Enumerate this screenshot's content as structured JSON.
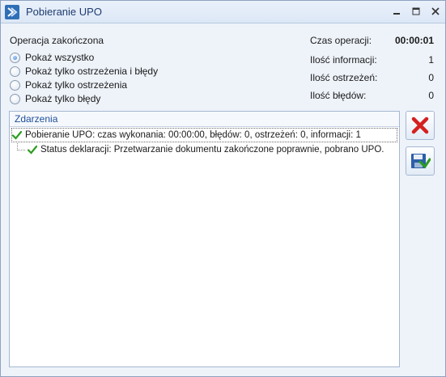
{
  "window": {
    "title": "Pobieranie UPO"
  },
  "status": {
    "title": "Operacja zakończona",
    "filters": [
      {
        "label": "Pokaż wszystko",
        "checked": true
      },
      {
        "label": "Pokaż tylko ostrzeżenia i błędy",
        "checked": false
      },
      {
        "label": "Pokaż tylko ostrzeżenia",
        "checked": false
      },
      {
        "label": "Pokaż tylko błędy",
        "checked": false
      }
    ]
  },
  "stats": {
    "time_label": "Czas operacji:",
    "time_value": "00:00:01",
    "info_label": "Ilość informacji:",
    "info_value": "1",
    "warn_label": "Ilość ostrzeżeń:",
    "warn_value": "0",
    "error_label": "Ilość błędów:",
    "error_value": "0"
  },
  "events": {
    "header": "Zdarzenia",
    "items": [
      {
        "text": "Pobieranie UPO: czas wykonania: 00:00:00, błędów: 0, ostrzeżeń: 0, informacji: 1"
      },
      {
        "text": "Status deklaracji: Przetwarzanie dokumentu zakończone poprawnie, pobrano UPO."
      }
    ]
  },
  "icons": {
    "app": "app-icon",
    "minimize": "minimize-icon",
    "maximize": "maximize-icon",
    "close": "close-icon",
    "success": "checkmark-icon",
    "cancel": "red-x-icon",
    "save": "save-disk-icon"
  },
  "colors": {
    "accent": "#1f4f9a",
    "success": "#2a9d1f",
    "error": "#d42020"
  }
}
